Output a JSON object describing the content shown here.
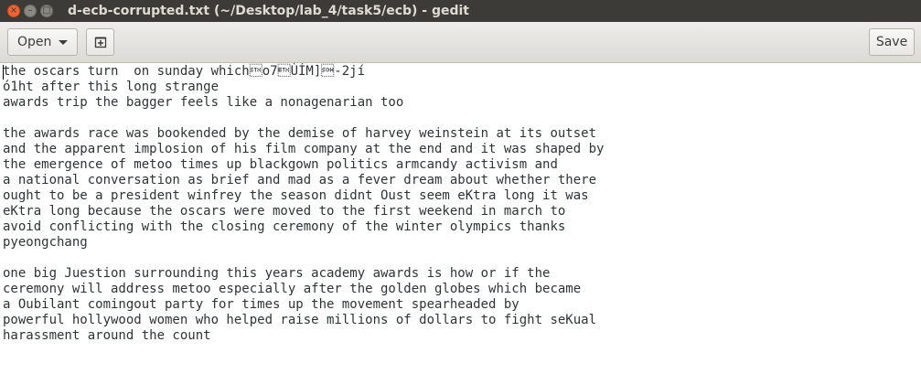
{
  "window": {
    "title": "d-ecb-corrupted.txt (~/Desktop/lab_4/task5/ecb) - gedit",
    "close_glyph": "×",
    "minimize_glyph": "–",
    "maximize_glyph": "□"
  },
  "toolbar": {
    "open_label": "Open",
    "new_tab_icon": "⊞",
    "save_label": "Save"
  },
  "editor": {
    "lines": [
      "the oscars turn  on sunday which\u0002o7\u0003ÙÍM]\u0001-2jí",
      "ó1ht after this long strange",
      "awards trip the bagger feels like a nonagenarian too",
      "",
      "the awards race was bookended by the demise of harvey weinstein at its outset",
      "and the apparent implosion of his film company at the end and it was shaped by",
      "the emergence of metoo times up blackgown politics armcandy activism and",
      "a national conversation as brief and mad as a fever dream about whether there",
      "ought to be a president winfrey the season didnt Oust seem eKtra long it was",
      "eKtra long because the oscars were moved to the first weekend in march to",
      "avoid conflicting with the closing ceremony of the winter olympics thanks",
      "pyeongchang",
      "",
      "one big Juestion surrounding this years academy awards is how or if the",
      "ceremony will address metoo especially after the golden globes which became",
      "a Oubilant comingout party for times up the movement spearheaded by",
      "powerful hollywood women who helped raise millions of dollars to fight seKual",
      "harassment around the count"
    ]
  }
}
